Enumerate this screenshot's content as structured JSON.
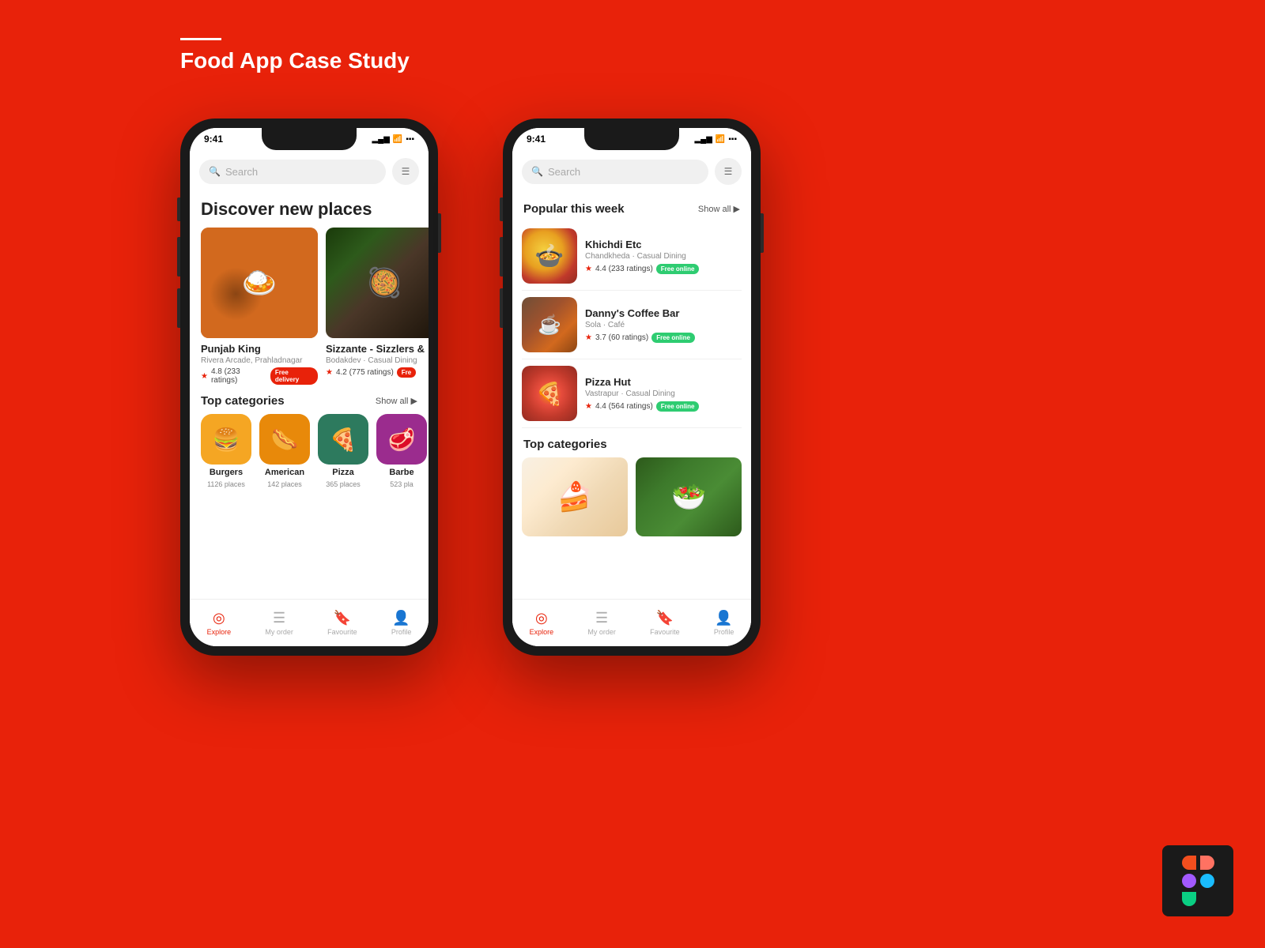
{
  "page": {
    "title": "Food App Case Study",
    "background_color": "#e8220a"
  },
  "phone1": {
    "status": {
      "time": "9:41",
      "signal": "▂▄▆",
      "wifi": "wifi",
      "battery": "battery"
    },
    "search": {
      "placeholder": "Search",
      "filter_icon": "≡"
    },
    "discover": {
      "title": "Discover new places"
    },
    "restaurants": [
      {
        "name": "Punjab King",
        "location": "Rivera Arcade, Prahladnagar",
        "rating": "4.8",
        "ratings_count": "(233 ratings)",
        "badge": "Free delivery",
        "badge_type": "delivery"
      },
      {
        "name": "Sizzante - Sizzlers &",
        "location": "Bodakdev · Casual Dining",
        "rating": "4.2",
        "ratings_count": "(775 ratings)",
        "badge": "Fre",
        "badge_type": "delivery"
      }
    ],
    "categories": {
      "title": "Top categories",
      "show_all": "Show all",
      "items": [
        {
          "name": "Burgers",
          "count": "1126 places",
          "color": "burger",
          "icon": "🍔"
        },
        {
          "name": "American",
          "count": "142 places",
          "color": "american",
          "icon": "🌭"
        },
        {
          "name": "Pizza",
          "count": "365 places",
          "color": "pizza",
          "icon": "🍕"
        },
        {
          "name": "Barbe",
          "count": "523 pla",
          "color": "barbe",
          "icon": "🥩"
        }
      ]
    },
    "nav": {
      "items": [
        {
          "label": "Explore",
          "active": true,
          "icon": "◎"
        },
        {
          "label": "My order",
          "active": false,
          "icon": "☰"
        },
        {
          "label": "Favourite",
          "active": false,
          "icon": "🔖"
        },
        {
          "label": "Profile",
          "active": false,
          "icon": "👤"
        }
      ]
    }
  },
  "phone2": {
    "status": {
      "time": "9:41"
    },
    "search": {
      "placeholder": "Search"
    },
    "popular": {
      "title": "Popular this week",
      "show_all": "Show all",
      "restaurants": [
        {
          "name": "Khichdi Etc",
          "location": "Chandkheda · Casual Dining",
          "rating": "4.4",
          "ratings_count": "(233 ratings)",
          "badge": "Free online",
          "badge_type": "online"
        },
        {
          "name": "Danny's Coffee Bar",
          "location": "Sola · Café",
          "rating": "3.7",
          "ratings_count": "(60 ratings)",
          "badge": "Free online",
          "badge_type": "online"
        },
        {
          "name": "Pizza Hut",
          "location": "Vastrapur · Casual Dining",
          "rating": "4.4",
          "ratings_count": "(564 ratings)",
          "badge": "Free online",
          "badge_type": "online"
        }
      ]
    },
    "categories": {
      "title": "Top categories"
    },
    "nav": {
      "items": [
        {
          "label": "Explore",
          "active": true,
          "icon": "◎"
        },
        {
          "label": "My order",
          "active": false,
          "icon": "☰"
        },
        {
          "label": "Favourite",
          "active": false,
          "icon": "🔖"
        },
        {
          "label": "Profile",
          "active": false,
          "icon": "👤"
        }
      ]
    }
  },
  "figma": {
    "label": "Figma logo"
  }
}
